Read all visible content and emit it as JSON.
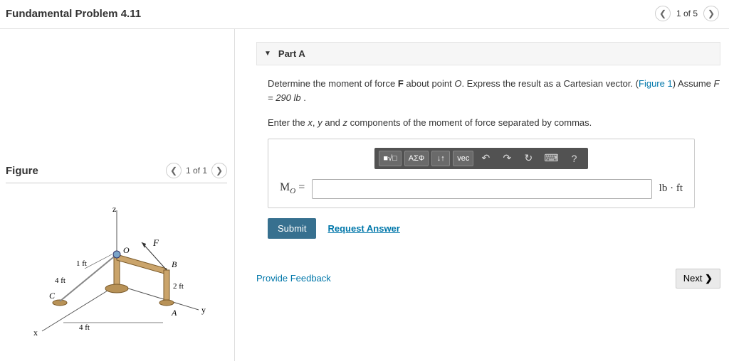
{
  "header": {
    "title": "Fundamental Problem 4.11",
    "page_label": "1 of 5"
  },
  "figure": {
    "heading": "Figure",
    "page_label": "1 of 1",
    "labels": {
      "z": "z",
      "x": "x",
      "y": "y",
      "F": "F",
      "O": "O",
      "A": "A",
      "B": "B",
      "C": "C",
      "d1": "1 ft",
      "d2": "4 ft",
      "d3": "4 ft",
      "d4": "2 ft"
    }
  },
  "part": {
    "collapse_glyph": "▼",
    "label": "Part A",
    "prompt_pre": "Determine the moment of force ",
    "prompt_F": "F",
    "prompt_mid1": " about point ",
    "prompt_O": "O",
    "prompt_mid2": ". Express the result as a Cartesian vector. (",
    "prompt_link": "Figure 1",
    "prompt_mid3": ") Assume ",
    "prompt_assume": "F = 290 lb",
    "prompt_end": " .",
    "instruction_pre": "Enter the ",
    "instr_x": "x",
    "instr_sep1": ", ",
    "instr_y": "y",
    "instr_sep2": " and ",
    "instr_z": "z",
    "instruction_post": " components of the moment of force separated by commas."
  },
  "toolbar": {
    "templates": "■√□",
    "greek": "ΑΣФ",
    "subsup": "↓↑",
    "vec": "vec",
    "undo": "↶",
    "redo": "↷",
    "reset": "↻",
    "keyboard": "⌨",
    "help": "?"
  },
  "answer": {
    "var_label_pre": "M",
    "var_label_sub": "O",
    "var_label_post": " =",
    "value": "",
    "unit": "lb · ft"
  },
  "actions": {
    "submit": "Submit",
    "request": "Request Answer"
  },
  "footer": {
    "feedback": "Provide Feedback",
    "next": "Next",
    "next_glyph": " ❯"
  }
}
